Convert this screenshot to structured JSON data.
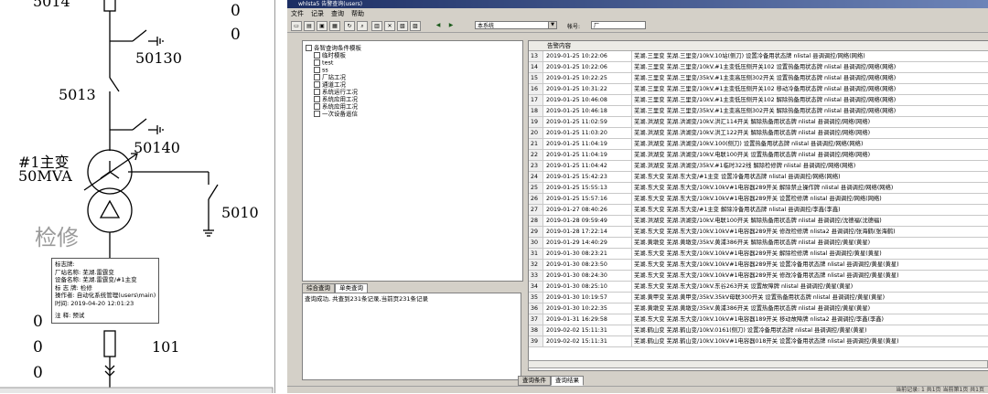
{
  "diagram": {
    "top_label": "5014",
    "right_zero_1": "0",
    "right_zero_2": "0",
    "switch_a": "50130",
    "switch_b": "5013",
    "switch_c": "50140",
    "transformer_name": "#1主变",
    "transformer_rating": "50MVA",
    "switch_d": "5010",
    "overhaul_label": "检修",
    "left_zero_1": "0",
    "left_zero_2": "0",
    "left_zero_3": "0",
    "right_num": "101",
    "tag": {
      "line1": "标志牌:",
      "line2": "厂站名称: 芜湖.雷霆变",
      "line3": "设备名称: 芜湖.雷霆变/#1主变",
      "line4": "标 志 牌: 检修",
      "line5": "操作者: 自动化系统管理(users\\main)",
      "line6": "时间: 2019-04-20 12:01:23",
      "line7": "注 释: 预试"
    }
  },
  "app": {
    "title": "whlsta5 告警查询(users)",
    "menu": [
      "文件",
      "记录",
      "查询",
      "帮助"
    ],
    "system_select": "本系统",
    "account_label": "帐号:",
    "account_value": "厂",
    "tree": [
      "各智查询条件模板",
      "临时模板",
      "test",
      "ss",
      "厂站工况",
      "通道工况",
      "系统运行工况",
      "系统应用工况",
      "系统应用工况",
      "一次设备遥信"
    ],
    "left_tabs": [
      "综合查询",
      "单类查询"
    ],
    "message": "查询成功, 共查到231条记录,当前页231条记录",
    "grid_header": "告警内容",
    "rows": [
      {
        "n": "13",
        "t": "2019-01-25 10:22:06",
        "d": "芜湖.三里变 芜湖.三里变/10kV.10站(侧刀) 设置冷备用状态牌 nlistal 县调调控/网络(网络)"
      },
      {
        "n": "14",
        "t": "2019-01-25 10:22:06",
        "d": "芜湖.三里变 芜湖.三里变/10kV.#1主变低压侧开关102 设置热备用状态牌 nlistal 县调调控/网络(网络)"
      },
      {
        "n": "15",
        "t": "2019-01-25 10:22:25",
        "d": "芜湖.三里变 芜湖.三里变/35kV.#1主变高压侧302开关 设置热备用状态牌 nlistal 县调调控/网络(网络)"
      },
      {
        "n": "16",
        "t": "2019-01-25 10:31:22",
        "d": "芜湖.三里变 芜湖.三里变/10kV.#1主变低压侧开关102 移动冷备用状态牌 nlistal 县调调控/网络(网络)"
      },
      {
        "n": "17",
        "t": "2019-01-25 10:46:08",
        "d": "芜湖.三里变 芜湖.三里变/10kV.#1主变低压侧开关102 解除热备用状态牌 nlistal 县调调控/网络(网络)"
      },
      {
        "n": "18",
        "t": "2019-01-25 10:46:18",
        "d": "芜湖.三里变 芜湖.三里变/35kV.#1主变高压侧302开关 解除热备用状态牌 nlistal 县调调控/网络(网络)"
      },
      {
        "n": "19",
        "t": "2019-01-25 11:02:59",
        "d": "芜湖.洪湖变 芜湖.洪湖变/10kV.洪汇114开关 解除热备用状态牌 nlistal 县调调控/网络(网络)"
      },
      {
        "n": "20",
        "t": "2019-01-25 11:03:20",
        "d": "芜湖.洪湖变 芜湖.洪湖变/10kV.洪工122开关 解除热备用状态牌 nlistal 县调调控/网络(网络)"
      },
      {
        "n": "21",
        "t": "2019-01-25 11:04:19",
        "d": "芜湖.洪湖变 芜湖.洪湖变/10kV.100(侧刀) 设置热备用状态牌 nlistal 县调调控/网络(网络)"
      },
      {
        "n": "22",
        "t": "2019-01-25 11:04:19",
        "d": "芜湖.洪湖变 芜湖.洪湖变/10kV.电联100开关 设置热备用状态牌 nlistal 县调调控/网络(网络)"
      },
      {
        "n": "23",
        "t": "2019-01-25 11:04:42",
        "d": "芜湖.洪湖变 芜湖.洪湖变/35kV.#1临时322线 解除检修牌 nlistal 县调调控/网络(网络)"
      },
      {
        "n": "24",
        "t": "2019-01-25 15:42:23",
        "d": "芜湖.东大变 芜湖.东大变/#1主变 设置冷备用状态牌 nlistal 县调调控/网络(网络)"
      },
      {
        "n": "25",
        "t": "2019-01-25 15:55:13",
        "d": "芜湖.东大变 芜湖.东大变/10kV.10kV#1电容器289开关 解除禁止操作牌 nlistal 县调调控/网络(网络)"
      },
      {
        "n": "26",
        "t": "2019-01-25 15:57:16",
        "d": "芜湖.东大变 芜湖.东大变/10kV.10kV#1电容器289开关 设置检修牌 nlistal 县调调控/网络(网络)"
      },
      {
        "n": "27",
        "t": "2019-01-27 08:40:26",
        "d": "芜湖.东大变 芜湖.东大变/#1主变 解除冷备用状态牌 nlistal 县调调控/李鑫(李鑫)"
      },
      {
        "n": "28",
        "t": "2019-01-28 09:59:49",
        "d": "芜湖.洪湖变 芜湖.洪湖变/10kV.电联100开关 解除热备用状态牌 nlistal 县调调控/沈德福(沈德福)"
      },
      {
        "n": "29",
        "t": "2019-01-28 17:22:14",
        "d": "芜湖.东大变 芜湖.东大变/10kV.10kV#1电容器289开关 修改检修牌 nlista2 县调调控/张海鹤(张海鹤)"
      },
      {
        "n": "30",
        "t": "2019-01-29 14:40:29",
        "d": "芜湖.黄墩变 芜湖.黄墩变/35kV.黄浦386开关 解除热备用状态牌 nlistal 县调调控/黄星(黄星)"
      },
      {
        "n": "31",
        "t": "2019-01-30 08:23:21",
        "d": "芜湖.东大变 芜湖.东大变/10kV.10kV#1电容器289开关 解除检修牌 nlistal 县调调控/黄星(黄星)"
      },
      {
        "n": "32",
        "t": "2019-01-30 08:23:50",
        "d": "芜湖.东大变 芜湖.东大变/10kV.10kV#1电容器289开关 设置冷备用状态牌 nlistal 县调调控/黄星(黄星)"
      },
      {
        "n": "33",
        "t": "2019-01-30 08:24:30",
        "d": "芜湖.东大变 芜湖.东大变/10kV.10kV#1电容器289开关 修改冷备用状态牌 nlistal 县调调控/黄星(黄星)"
      },
      {
        "n": "34",
        "t": "2019-01-30 08:25:10",
        "d": "芜湖.东大变 芜湖.东大变/10kV.东谷263开关 设置故障牌 nlistal 县调调控/黄星(黄星)"
      },
      {
        "n": "35",
        "t": "2019-01-30 10:19:57",
        "d": "芜湖.黄甲变 芜湖.黄甲变/35kV.35kV母联300开关 设置热备用状态牌 nlistal 县调调控/黄星(黄星)"
      },
      {
        "n": "36",
        "t": "2019-01-30 10:22:35",
        "d": "芜湖.黄墩变 芜湖.黄墩变/35kV.黄浦386开关 设置热备用状态牌 nlistal 县调调控/黄星(黄星)"
      },
      {
        "n": "37",
        "t": "2019-01-31 16:29:58",
        "d": "芜湖.东大变 芜湖.东大变/10kV.10kV#1电容器189开关 移动故障牌 nlista2 县调调控/李鑫(李鑫)"
      },
      {
        "n": "38",
        "t": "2019-02-02 15:11:31",
        "d": "芜湖.鹤山变 芜湖.鹤山变/10kV.0161(侧刀) 设置冷备用状态牌 nlistal 县调调控/黄星(黄星)"
      },
      {
        "n": "39",
        "t": "2019-02-02 15:11:31",
        "d": "芜湖.鹤山变 芜湖.鹤山变/10kV.10kV#1电容器018开关 设置冷备用状态牌 nlistal 县调调控/黄星(黄星)"
      }
    ],
    "right_tabs": [
      "查询条件",
      "查询结果"
    ],
    "status": "当前记录: 1 共1页 当前第1页 共1页"
  }
}
